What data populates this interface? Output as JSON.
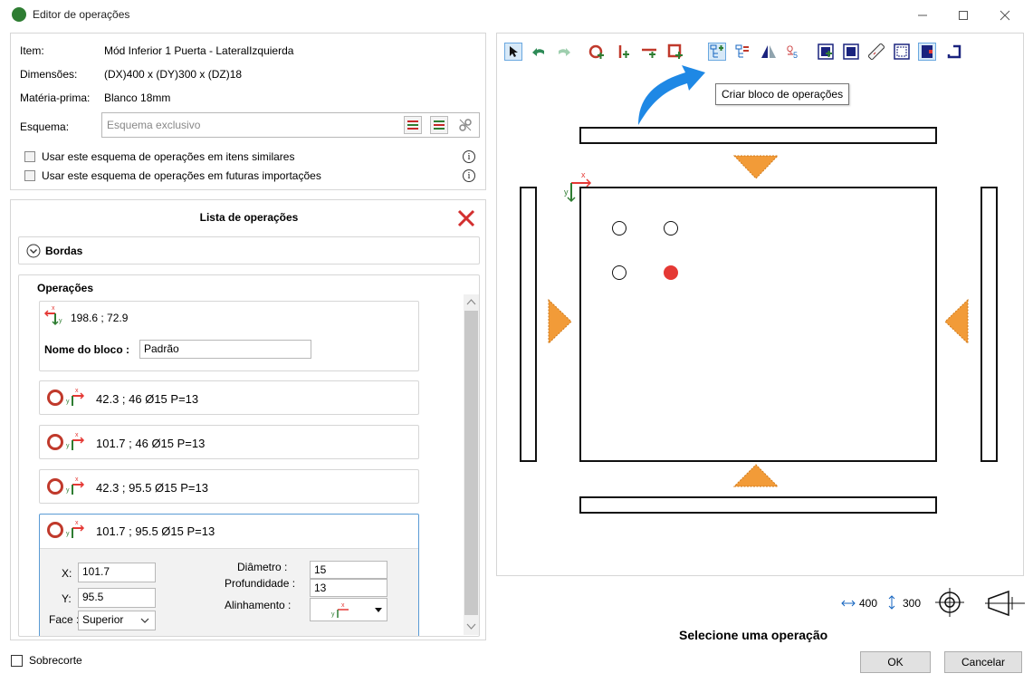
{
  "window": {
    "title": "Editor de operações",
    "min_icon": "minimize-icon",
    "max_icon": "maximize-icon",
    "close_icon": "close-icon"
  },
  "item_info": {
    "item_label": "Item:",
    "item_value": "Mód Inferior 1 Puerta  - LateralIzquierda",
    "dim_label": "Dimensões:",
    "dim_value": "(DX)400 x (DY)300 x (DZ)18",
    "material_label": "Matéria-prima:",
    "material_value": "Blanco 18mm",
    "scheme_label": "Esquema:",
    "scheme_placeholder": "Esquema exclusivo",
    "similar_label": "Usar este esquema de operações em itens similares",
    "future_label": "Usar este esquema de operações em futuras importações"
  },
  "operations_list": {
    "title": "Lista de operações",
    "edges_label": "Bordas",
    "operations_label": "Operações",
    "block": {
      "coords": "198.6 ; 72.9",
      "name_label": "Nome do bloco :",
      "name_value": "Padrão"
    },
    "items": [
      {
        "text": "42.3 ; 46 Ø15 P=13"
      },
      {
        "text": "101.7 ; 46 Ø15 P=13"
      },
      {
        "text": "42.3 ; 95.5 Ø15 P=13"
      },
      {
        "text": "101.7 ; 95.5 Ø15 P=13"
      }
    ],
    "detail": {
      "x_label": "X:",
      "x_value": "101.7",
      "y_label": "Y:",
      "y_value": "95.5",
      "face_label": "Face :",
      "face_value": "Superior",
      "diameter_label": "Diâmetro :",
      "diameter_value": "15",
      "depth_label": "Profundidade :",
      "depth_value": "13",
      "align_label": "Alinhamento :"
    }
  },
  "oversize_label": "Sobrecorte",
  "tooltip": "Criar bloco de operações",
  "status": {
    "dx": "400",
    "dy": "300",
    "select_msg": "Selecione uma operação"
  },
  "buttons": {
    "ok": "OK",
    "cancel": "Cancelar"
  },
  "colors": {
    "accent_blue": "#1e88e5",
    "triangle_orange": "#f29b38",
    "hole_red": "#e53935",
    "ring_red": "#c0392b",
    "close_red": "#d32f2f"
  }
}
